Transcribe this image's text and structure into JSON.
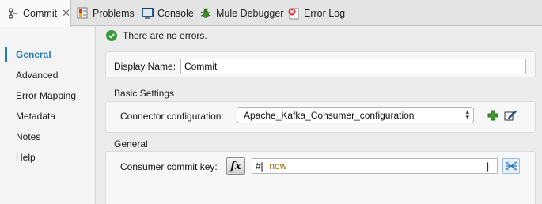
{
  "tabs": [
    {
      "label": "Commit",
      "icon": "connector-icon",
      "active": true
    },
    {
      "label": "Problems",
      "icon": "problems-icon"
    },
    {
      "label": "Console",
      "icon": "console-icon"
    },
    {
      "label": "Mule Debugger",
      "icon": "debugger-bug-icon"
    },
    {
      "label": "Error Log",
      "icon": "error-log-icon"
    }
  ],
  "sidebar": {
    "items": [
      {
        "label": "General",
        "active": true
      },
      {
        "label": "Advanced"
      },
      {
        "label": "Error Mapping"
      },
      {
        "label": "Metadata"
      },
      {
        "label": "Notes"
      },
      {
        "label": "Help"
      }
    ]
  },
  "status": {
    "text": "There are no errors.",
    "icon": "check-circle-icon"
  },
  "form": {
    "display_name_label": "Display Name:",
    "display_name_value": "Commit",
    "basic_settings_title": "Basic Settings",
    "connector_config_label": "Connector configuration:",
    "connector_config_value": "Apache_Kafka_Consumer_configuration",
    "general_title": "General",
    "commit_key_label": "Consumer commit key:",
    "commit_key_prefix": "#[",
    "commit_key_expr": "now",
    "commit_key_suffix": "]",
    "fx_label": "fx"
  },
  "colors": {
    "accent": "#2a7ab6",
    "ok": "#3b9a3b",
    "add": "#3e9b2e"
  }
}
